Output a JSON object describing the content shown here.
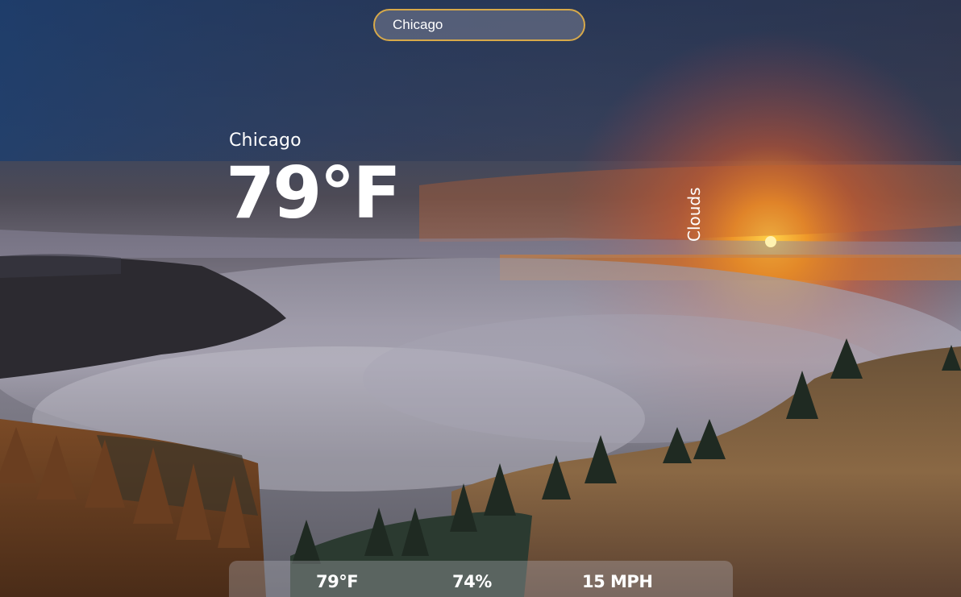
{
  "search": {
    "value": "Chicago"
  },
  "current": {
    "city": "Chicago",
    "temperature": "79°F",
    "description": "Clouds"
  },
  "stats": {
    "feels_like": "79°F",
    "humidity": "74%",
    "wind": "15 MPH"
  }
}
